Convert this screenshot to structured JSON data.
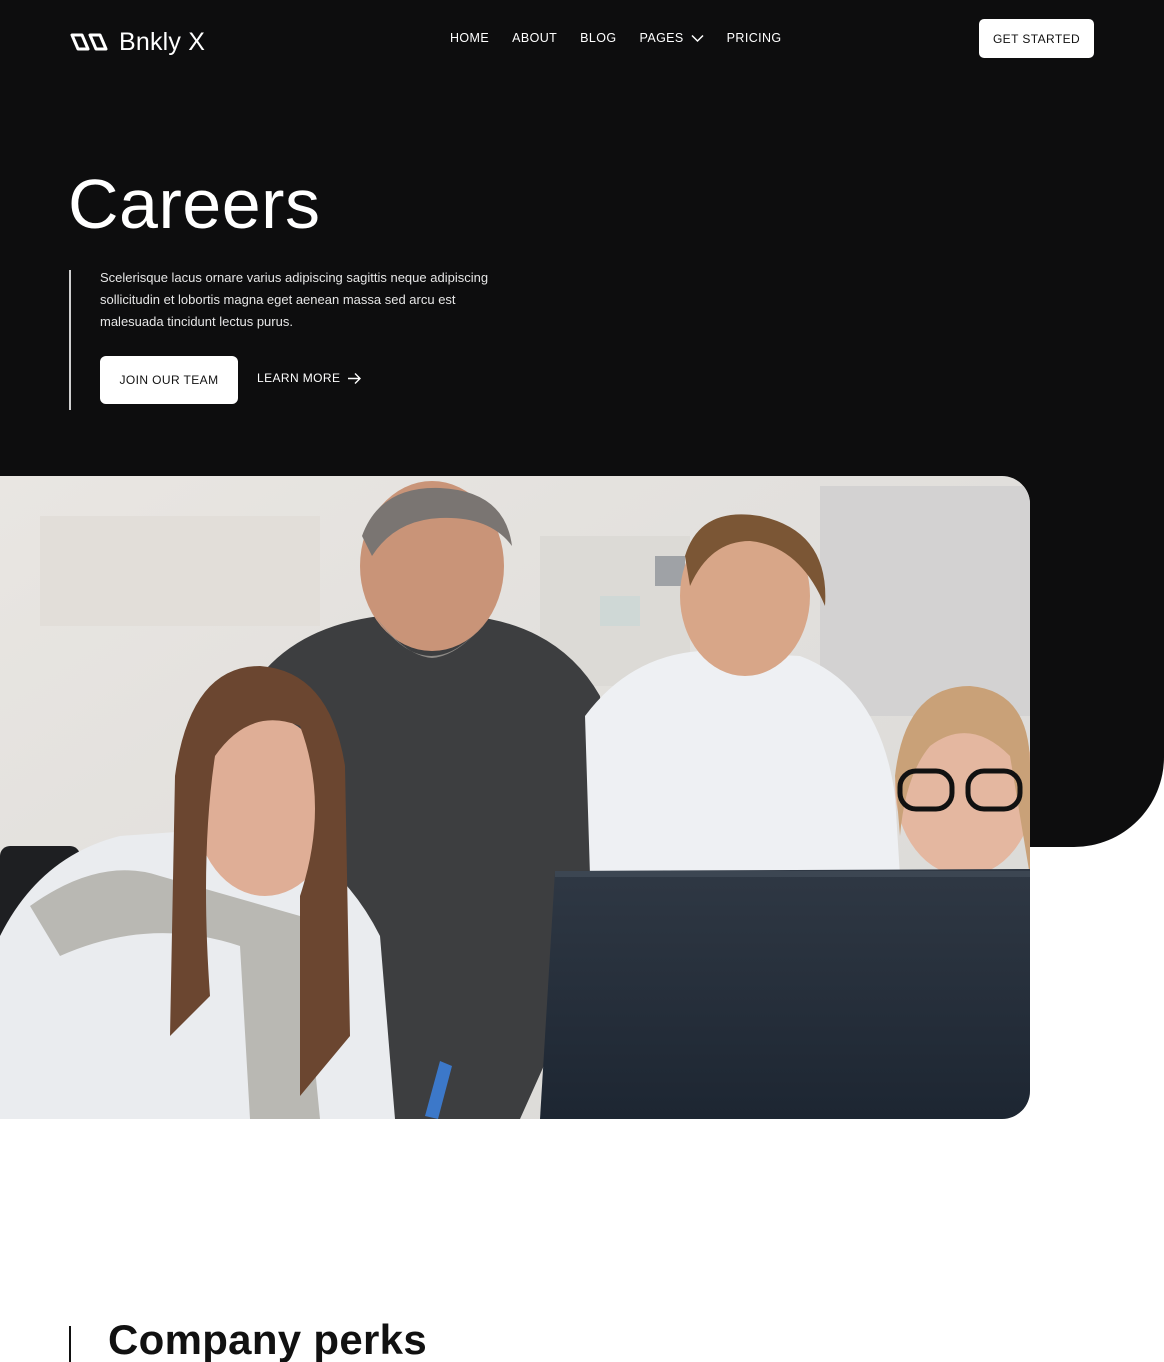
{
  "brand": {
    "name": "Bnkly X",
    "logo_icon": "logo-icon"
  },
  "nav": {
    "items": [
      {
        "label": "HOME"
      },
      {
        "label": "ABOUT"
      },
      {
        "label": "BLOG"
      },
      {
        "label": "PAGES",
        "icon": "chevron-down-icon"
      },
      {
        "label": "PRICING"
      }
    ],
    "cta_label": "GET STARTED"
  },
  "hero": {
    "title": "Careers",
    "description": "Scelerisque lacus ornare varius adipiscing sagittis neque adipiscing sollicitudin et lobortis magna eget aenean massa sed arcu est malesuada tincidunt lectus purus.",
    "primary_cta": "JOIN OUR TEAM",
    "secondary_cta": "LEARN MORE",
    "secondary_icon": "arrow-right-icon"
  },
  "perks": {
    "title": "Company perks"
  },
  "colors": {
    "dark_bg": "#0d0d0e",
    "text_light": "#ffffff",
    "button_bg": "#ffffff"
  }
}
